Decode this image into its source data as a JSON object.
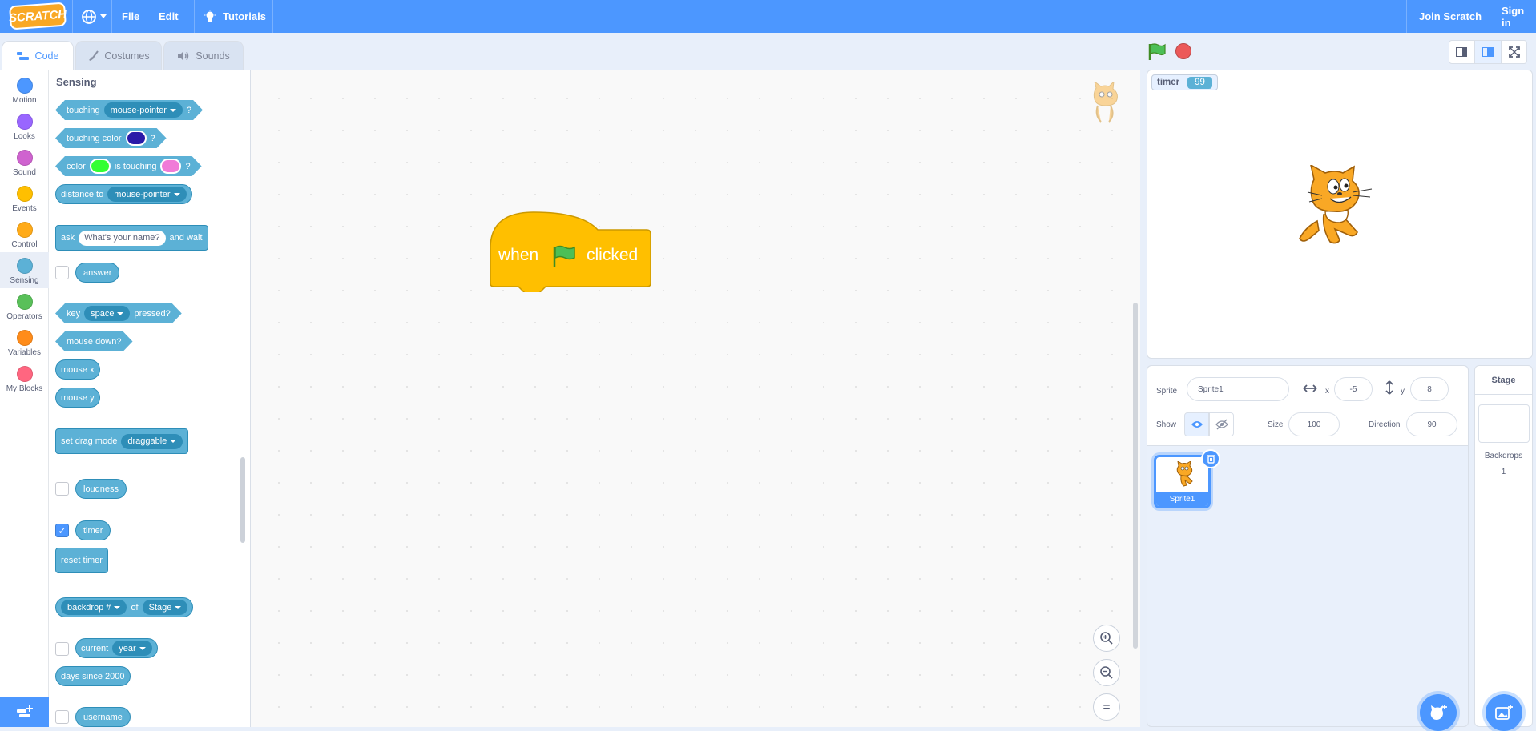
{
  "menubar": {
    "logo": "SCRATCH",
    "file": "File",
    "edit": "Edit",
    "tutorials": "Tutorials",
    "join": "Join Scratch",
    "signin": "Sign in"
  },
  "tabs": {
    "code": "Code",
    "costumes": "Costumes",
    "sounds": "Sounds"
  },
  "categories": [
    {
      "label": "Motion",
      "color": "#4c97ff"
    },
    {
      "label": "Looks",
      "color": "#9966ff"
    },
    {
      "label": "Sound",
      "color": "#cf63cf"
    },
    {
      "label": "Events",
      "color": "#ffbf00"
    },
    {
      "label": "Control",
      "color": "#ffab19"
    },
    {
      "label": "Sensing",
      "color": "#5cb1d6"
    },
    {
      "label": "Operators",
      "color": "#59c059"
    },
    {
      "label": "Variables",
      "color": "#ff8c1a"
    },
    {
      "label": "My Blocks",
      "color": "#ff6680"
    }
  ],
  "palette": {
    "heading": "Sensing",
    "touching": "touching",
    "mouse_pointer": "mouse-pointer",
    "q": "?",
    "touching_color": "touching color",
    "color": "color",
    "is_touching": "is touching",
    "distance_to": "distance to",
    "ask": "ask",
    "ask_default": "What's your name?",
    "and_wait": "and wait",
    "answer": "answer",
    "key": "key",
    "space": "space",
    "pressed": "pressed?",
    "mouse_down": "mouse down?",
    "mouse_x": "mouse x",
    "mouse_y": "mouse y",
    "set_drag_mode": "set drag mode",
    "draggable": "draggable",
    "loudness": "loudness",
    "timer": "timer",
    "reset_timer": "reset timer",
    "backdrop_num": "backdrop #",
    "of": "of",
    "stage": "Stage",
    "current": "current",
    "year": "year",
    "days_since": "days since 2000",
    "username": "username",
    "colors": {
      "sensing": "#5cb1d6",
      "swatch1": "#2a1aa8",
      "swatch2": "#33ff33",
      "swatch3": "#f07bd8"
    }
  },
  "hat_block": {
    "when": "when",
    "clicked": "clicked",
    "color": "#ffbf00"
  },
  "stage": {
    "monitor_label": "timer",
    "monitor_value": "99"
  },
  "sprite_info": {
    "sprite_label": "Sprite",
    "sprite_name": "Sprite1",
    "x_label": "x",
    "x_value": "-5",
    "y_label": "y",
    "y_value": "8",
    "show_label": "Show",
    "size_label": "Size",
    "size_value": "100",
    "direction_label": "Direction",
    "direction_value": "90"
  },
  "sprite_list": [
    {
      "name": "Sprite1"
    }
  ],
  "stage_pane": {
    "title": "Stage",
    "backdrops_label": "Backdrops",
    "backdrops_count": "1"
  }
}
